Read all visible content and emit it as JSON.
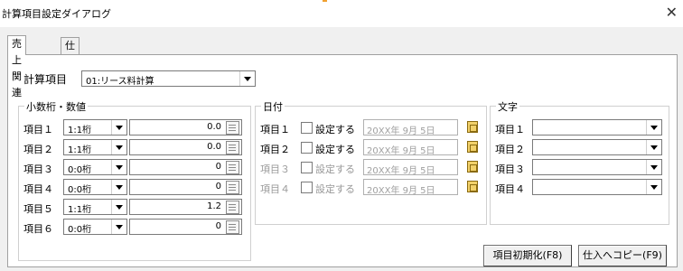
{
  "window": {
    "title": "計算項目設定ダイアログ",
    "close_glyph": "✕"
  },
  "tabs": [
    {
      "label": "売上関連"
    },
    {
      "label": "仕入関連"
    }
  ],
  "calc_item": {
    "label": "計算項目",
    "value": "01:リース料計算"
  },
  "decimal_group": {
    "legend": "小数桁・数値",
    "rows": [
      {
        "label": "項目１",
        "digits": "1:1桁",
        "value": "0.0"
      },
      {
        "label": "項目２",
        "digits": "1:1桁",
        "value": "0.0"
      },
      {
        "label": "項目３",
        "digits": "0:0桁",
        "value": "0"
      },
      {
        "label": "項目４",
        "digits": "0:0桁",
        "value": "0"
      },
      {
        "label": "項目５",
        "digits": "1:1桁",
        "value": "1.2"
      },
      {
        "label": "項目６",
        "digits": "0:0桁",
        "value": "0"
      }
    ]
  },
  "date_group": {
    "legend": "日付",
    "rows": [
      {
        "label": "項目１",
        "check_label": "設定する",
        "date": "20XX年 9月 5日",
        "enabled": true
      },
      {
        "label": "項目２",
        "check_label": "設定する",
        "date": "20XX年 9月 5日",
        "enabled": true
      },
      {
        "label": "項目３",
        "check_label": "設定する",
        "date": "20XX年 9月 5日",
        "enabled": false
      },
      {
        "label": "項目４",
        "check_label": "設定する",
        "date": "20XX年 9月 5日",
        "enabled": false
      }
    ]
  },
  "text_group": {
    "legend": "文字",
    "rows": [
      {
        "label": "項目１",
        "value": ""
      },
      {
        "label": "項目２",
        "value": ""
      },
      {
        "label": "項目３",
        "value": ""
      },
      {
        "label": "項目４",
        "value": ""
      }
    ]
  },
  "buttons": {
    "reset": "項目初期化(F8)",
    "copy": "仕入へコピー(F9)"
  }
}
